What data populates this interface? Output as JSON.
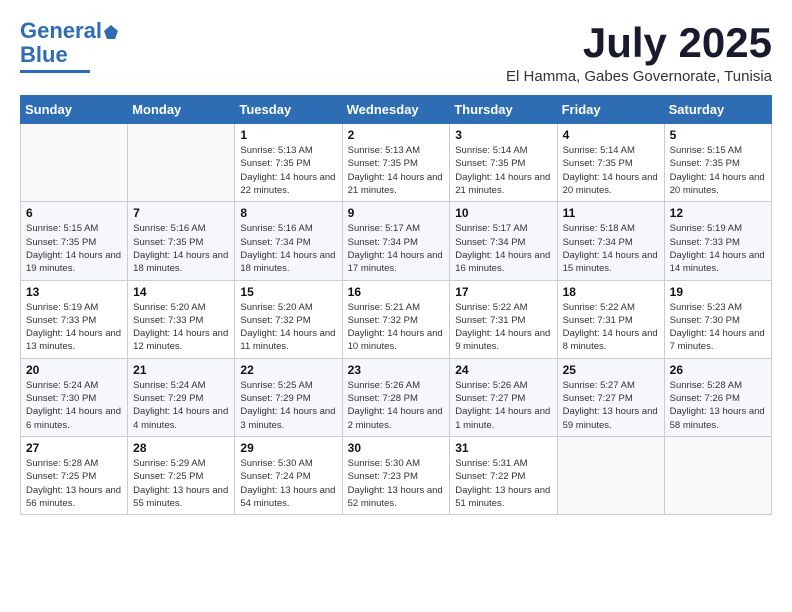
{
  "header": {
    "logo_general": "General",
    "logo_blue": "Blue",
    "month": "July 2025",
    "location": "El Hamma, Gabes Governorate, Tunisia"
  },
  "weekdays": [
    "Sunday",
    "Monday",
    "Tuesday",
    "Wednesday",
    "Thursday",
    "Friday",
    "Saturday"
  ],
  "weeks": [
    [
      {
        "day": "",
        "info": ""
      },
      {
        "day": "",
        "info": ""
      },
      {
        "day": "1",
        "info": "Sunrise: 5:13 AM\nSunset: 7:35 PM\nDaylight: 14 hours and 22 minutes."
      },
      {
        "day": "2",
        "info": "Sunrise: 5:13 AM\nSunset: 7:35 PM\nDaylight: 14 hours and 21 minutes."
      },
      {
        "day": "3",
        "info": "Sunrise: 5:14 AM\nSunset: 7:35 PM\nDaylight: 14 hours and 21 minutes."
      },
      {
        "day": "4",
        "info": "Sunrise: 5:14 AM\nSunset: 7:35 PM\nDaylight: 14 hours and 20 minutes."
      },
      {
        "day": "5",
        "info": "Sunrise: 5:15 AM\nSunset: 7:35 PM\nDaylight: 14 hours and 20 minutes."
      }
    ],
    [
      {
        "day": "6",
        "info": "Sunrise: 5:15 AM\nSunset: 7:35 PM\nDaylight: 14 hours and 19 minutes."
      },
      {
        "day": "7",
        "info": "Sunrise: 5:16 AM\nSunset: 7:35 PM\nDaylight: 14 hours and 18 minutes."
      },
      {
        "day": "8",
        "info": "Sunrise: 5:16 AM\nSunset: 7:34 PM\nDaylight: 14 hours and 18 minutes."
      },
      {
        "day": "9",
        "info": "Sunrise: 5:17 AM\nSunset: 7:34 PM\nDaylight: 14 hours and 17 minutes."
      },
      {
        "day": "10",
        "info": "Sunrise: 5:17 AM\nSunset: 7:34 PM\nDaylight: 14 hours and 16 minutes."
      },
      {
        "day": "11",
        "info": "Sunrise: 5:18 AM\nSunset: 7:34 PM\nDaylight: 14 hours and 15 minutes."
      },
      {
        "day": "12",
        "info": "Sunrise: 5:19 AM\nSunset: 7:33 PM\nDaylight: 14 hours and 14 minutes."
      }
    ],
    [
      {
        "day": "13",
        "info": "Sunrise: 5:19 AM\nSunset: 7:33 PM\nDaylight: 14 hours and 13 minutes."
      },
      {
        "day": "14",
        "info": "Sunrise: 5:20 AM\nSunset: 7:33 PM\nDaylight: 14 hours and 12 minutes."
      },
      {
        "day": "15",
        "info": "Sunrise: 5:20 AM\nSunset: 7:32 PM\nDaylight: 14 hours and 11 minutes."
      },
      {
        "day": "16",
        "info": "Sunrise: 5:21 AM\nSunset: 7:32 PM\nDaylight: 14 hours and 10 minutes."
      },
      {
        "day": "17",
        "info": "Sunrise: 5:22 AM\nSunset: 7:31 PM\nDaylight: 14 hours and 9 minutes."
      },
      {
        "day": "18",
        "info": "Sunrise: 5:22 AM\nSunset: 7:31 PM\nDaylight: 14 hours and 8 minutes."
      },
      {
        "day": "19",
        "info": "Sunrise: 5:23 AM\nSunset: 7:30 PM\nDaylight: 14 hours and 7 minutes."
      }
    ],
    [
      {
        "day": "20",
        "info": "Sunrise: 5:24 AM\nSunset: 7:30 PM\nDaylight: 14 hours and 6 minutes."
      },
      {
        "day": "21",
        "info": "Sunrise: 5:24 AM\nSunset: 7:29 PM\nDaylight: 14 hours and 4 minutes."
      },
      {
        "day": "22",
        "info": "Sunrise: 5:25 AM\nSunset: 7:29 PM\nDaylight: 14 hours and 3 minutes."
      },
      {
        "day": "23",
        "info": "Sunrise: 5:26 AM\nSunset: 7:28 PM\nDaylight: 14 hours and 2 minutes."
      },
      {
        "day": "24",
        "info": "Sunrise: 5:26 AM\nSunset: 7:27 PM\nDaylight: 14 hours and 1 minute."
      },
      {
        "day": "25",
        "info": "Sunrise: 5:27 AM\nSunset: 7:27 PM\nDaylight: 13 hours and 59 minutes."
      },
      {
        "day": "26",
        "info": "Sunrise: 5:28 AM\nSunset: 7:26 PM\nDaylight: 13 hours and 58 minutes."
      }
    ],
    [
      {
        "day": "27",
        "info": "Sunrise: 5:28 AM\nSunset: 7:25 PM\nDaylight: 13 hours and 56 minutes."
      },
      {
        "day": "28",
        "info": "Sunrise: 5:29 AM\nSunset: 7:25 PM\nDaylight: 13 hours and 55 minutes."
      },
      {
        "day": "29",
        "info": "Sunrise: 5:30 AM\nSunset: 7:24 PM\nDaylight: 13 hours and 54 minutes."
      },
      {
        "day": "30",
        "info": "Sunrise: 5:30 AM\nSunset: 7:23 PM\nDaylight: 13 hours and 52 minutes."
      },
      {
        "day": "31",
        "info": "Sunrise: 5:31 AM\nSunset: 7:22 PM\nDaylight: 13 hours and 51 minutes."
      },
      {
        "day": "",
        "info": ""
      },
      {
        "day": "",
        "info": ""
      }
    ]
  ]
}
